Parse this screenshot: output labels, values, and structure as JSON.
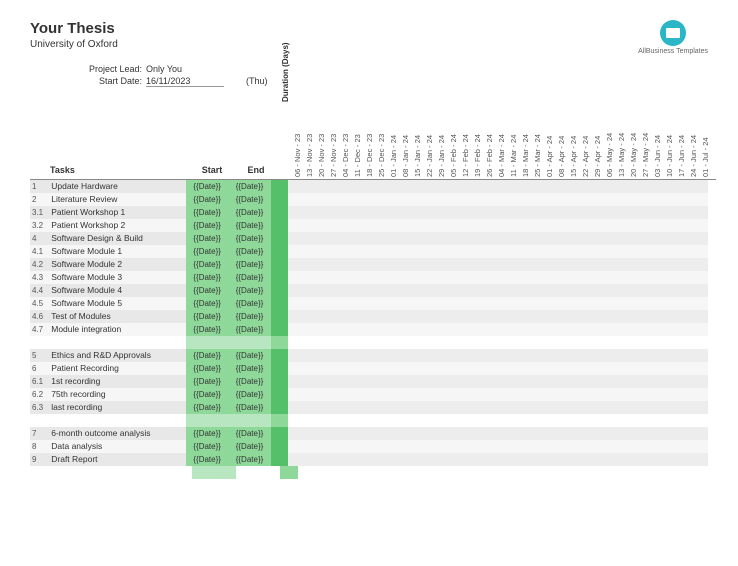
{
  "header": {
    "title": "Your Thesis",
    "subtitle": "University of Oxford"
  },
  "meta": {
    "lead_label": "Project Lead:",
    "lead_value": "Only You",
    "start_label": "Start Date:",
    "start_value": "16/11/2023",
    "start_day": "(Thu)"
  },
  "logo": {
    "text": "AllBusiness Templates"
  },
  "columns": {
    "tasks": "Tasks",
    "start": "Start",
    "end": "End",
    "duration": "Duration (Days)"
  },
  "dates": [
    "06 - Nov - 23",
    "13 - Nov - 23",
    "20 - Nov - 23",
    "27 - Nov - 23",
    "04 - Dec - 23",
    "11 - Dec - 23",
    "18 - Dec - 23",
    "25 - Dec - 23",
    "01 - Jan - 24",
    "08 - Jan - 24",
    "15 - Jan - 24",
    "22 - Jan - 24",
    "29 - Jan - 24",
    "05 - Feb - 24",
    "12 - Feb - 24",
    "19 - Feb - 24",
    "26 - Feb - 24",
    "04 - Mar - 24",
    "11 - Mar - 24",
    "18 - Mar - 24",
    "25 - Mar - 24",
    "01 - Apr - 24",
    "08 - Apr - 24",
    "15 - Apr - 24",
    "22 - Apr - 24",
    "29 - Apr - 24",
    "06 - May - 24",
    "13 - May - 24",
    "20 - May - 24",
    "27 - May - 24",
    "03 - Jun - 24",
    "10 - Jun - 24",
    "17 - Jun - 24",
    "24 - Jun - 24",
    "01 - Jul - 24"
  ],
  "groups": [
    {
      "rows": [
        {
          "id": "1",
          "task": "Update Hardware",
          "start": "{{Date}}",
          "end": "{{Date}}"
        },
        {
          "id": "2",
          "task": "Literature Review",
          "start": "{{Date}}",
          "end": "{{Date}}"
        },
        {
          "id": "3.1",
          "task": "Patient Workshop 1",
          "start": "{{Date}}",
          "end": "{{Date}}"
        },
        {
          "id": "3.2",
          "task": "Patient Workshop 2",
          "start": "{{Date}}",
          "end": "{{Date}}"
        },
        {
          "id": "4",
          "task": "Software Design & Build",
          "start": "{{Date}}",
          "end": "{{Date}}"
        },
        {
          "id": "4.1",
          "task": "Software Module 1",
          "start": "{{Date}}",
          "end": "{{Date}}"
        },
        {
          "id": "4.2",
          "task": "Software Module 2",
          "start": "{{Date}}",
          "end": "{{Date}}"
        },
        {
          "id": "4.3",
          "task": "Software Module 3",
          "start": "{{Date}}",
          "end": "{{Date}}"
        },
        {
          "id": "4.4",
          "task": "Software Module 4",
          "start": "{{Date}}",
          "end": "{{Date}}"
        },
        {
          "id": "4.5",
          "task": "Software Module 5",
          "start": "{{Date}}",
          "end": "{{Date}}"
        },
        {
          "id": "4.6",
          "task": "Test of Modules",
          "start": "{{Date}}",
          "end": "{{Date}}"
        },
        {
          "id": "4.7",
          "task": "Module integration",
          "start": "{{Date}}",
          "end": "{{Date}}"
        }
      ]
    },
    {
      "rows": [
        {
          "id": "5",
          "task": "Ethics and R&D Approvals",
          "start": "{{Date}}",
          "end": "{{Date}}"
        },
        {
          "id": "6",
          "task": "Patient Recording",
          "start": "{{Date}}",
          "end": "{{Date}}"
        },
        {
          "id": "6.1",
          "task": "1st recording",
          "start": "{{Date}}",
          "end": "{{Date}}"
        },
        {
          "id": "6.2",
          "task": "75th recording",
          "start": "{{Date}}",
          "end": "{{Date}}"
        },
        {
          "id": "6.3",
          "task": "last recording",
          "start": "{{Date}}",
          "end": "{{Date}}"
        }
      ]
    },
    {
      "rows": [
        {
          "id": "7",
          "task": "6-month outcome analysis",
          "start": "{{Date}}",
          "end": "{{Date}}"
        },
        {
          "id": "8",
          "task": "Data analysis",
          "start": "{{Date}}",
          "end": "{{Date}}"
        },
        {
          "id": "9",
          "task": "Draft Report",
          "start": "{{Date}}",
          "end": "{{Date}}"
        }
      ]
    }
  ]
}
